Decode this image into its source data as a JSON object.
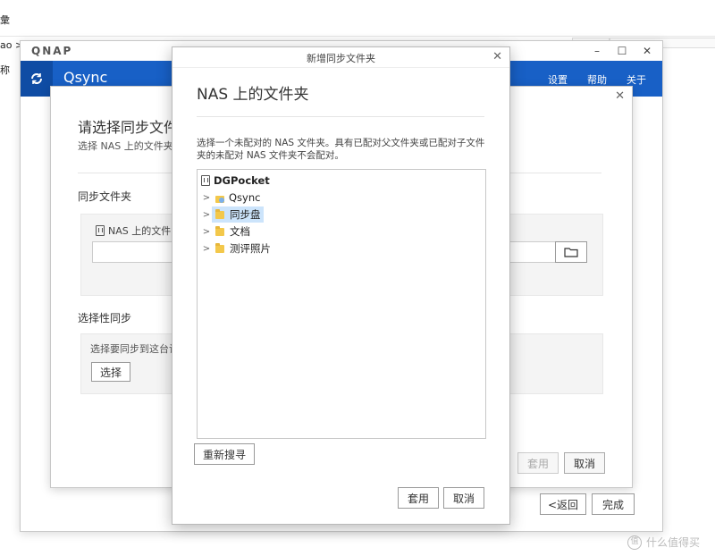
{
  "background": {
    "left_top_glyph": "彙",
    "left_path_text": "ao >",
    "left_label": "称"
  },
  "qnap_window": {
    "logo": "QNAP",
    "app_name": "Qsync",
    "nav": [
      "设置",
      "帮助",
      "关于"
    ],
    "min": "–",
    "max": "☐",
    "close": "✕"
  },
  "wizard": {
    "title": "请选择同步文件夹",
    "subtitle": "选择 NAS 上的文件夹和",
    "sync_folder_heading": "同步文件夹",
    "nas_folder_label": "NAS 上的文件",
    "selective_heading": "选择性同步",
    "selective_desc": "选择要同步到这台计",
    "select_button": "选择",
    "apply_button": "套用",
    "cancel_button": "取消",
    "back_button": "<返回",
    "finish_button": "完成",
    "close": "✕"
  },
  "dialog": {
    "title": "新增同步文件夹",
    "close": "✕",
    "heading": "NAS 上的文件夹",
    "description": "选择一个未配对的 NAS 文件夹。具有已配对父文件夹或已配对子文件夹的未配对 NAS 文件夹不会配对。",
    "tree": {
      "root": "DGPocket",
      "items": [
        {
          "label": "Qsync",
          "icon": "qsync-folder-icon"
        },
        {
          "label": "同步盘",
          "selected": true
        },
        {
          "label": "文档"
        },
        {
          "label": "测评照片"
        }
      ]
    },
    "rescan_button": "重新搜寻",
    "apply_button": "套用",
    "cancel_button": "取消"
  },
  "watermark": {
    "text": "什么值得买"
  },
  "colors": {
    "qsync_bar": "#1860c6",
    "selection": "#cce4fb",
    "folder": "#f3c84b"
  }
}
